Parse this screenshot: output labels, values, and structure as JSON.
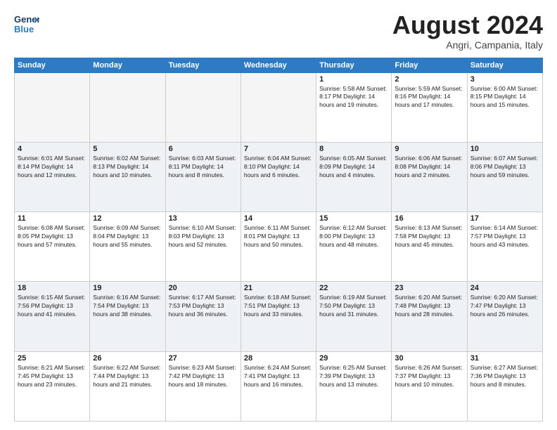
{
  "header": {
    "logo_line1": "General",
    "logo_line2": "Blue",
    "month": "August 2024",
    "location": "Angri, Campania, Italy"
  },
  "weekdays": [
    "Sunday",
    "Monday",
    "Tuesday",
    "Wednesday",
    "Thursday",
    "Friday",
    "Saturday"
  ],
  "weeks": [
    [
      {
        "day": "",
        "info": ""
      },
      {
        "day": "",
        "info": ""
      },
      {
        "day": "",
        "info": ""
      },
      {
        "day": "",
        "info": ""
      },
      {
        "day": "1",
        "info": "Sunrise: 5:58 AM\nSunset: 8:17 PM\nDaylight: 14 hours\nand 19 minutes."
      },
      {
        "day": "2",
        "info": "Sunrise: 5:59 AM\nSunset: 8:16 PM\nDaylight: 14 hours\nand 17 minutes."
      },
      {
        "day": "3",
        "info": "Sunrise: 6:00 AM\nSunset: 8:15 PM\nDaylight: 14 hours\nand 15 minutes."
      }
    ],
    [
      {
        "day": "4",
        "info": "Sunrise: 6:01 AM\nSunset: 8:14 PM\nDaylight: 14 hours\nand 12 minutes."
      },
      {
        "day": "5",
        "info": "Sunrise: 6:02 AM\nSunset: 8:13 PM\nDaylight: 14 hours\nand 10 minutes."
      },
      {
        "day": "6",
        "info": "Sunrise: 6:03 AM\nSunset: 8:11 PM\nDaylight: 14 hours\nand 8 minutes."
      },
      {
        "day": "7",
        "info": "Sunrise: 6:04 AM\nSunset: 8:10 PM\nDaylight: 14 hours\nand 6 minutes."
      },
      {
        "day": "8",
        "info": "Sunrise: 6:05 AM\nSunset: 8:09 PM\nDaylight: 14 hours\nand 4 minutes."
      },
      {
        "day": "9",
        "info": "Sunrise: 6:06 AM\nSunset: 8:08 PM\nDaylight: 14 hours\nand 2 minutes."
      },
      {
        "day": "10",
        "info": "Sunrise: 6:07 AM\nSunset: 8:06 PM\nDaylight: 13 hours\nand 59 minutes."
      }
    ],
    [
      {
        "day": "11",
        "info": "Sunrise: 6:08 AM\nSunset: 8:05 PM\nDaylight: 13 hours\nand 57 minutes."
      },
      {
        "day": "12",
        "info": "Sunrise: 6:09 AM\nSunset: 8:04 PM\nDaylight: 13 hours\nand 55 minutes."
      },
      {
        "day": "13",
        "info": "Sunrise: 6:10 AM\nSunset: 8:03 PM\nDaylight: 13 hours\nand 52 minutes."
      },
      {
        "day": "14",
        "info": "Sunrise: 6:11 AM\nSunset: 8:01 PM\nDaylight: 13 hours\nand 50 minutes."
      },
      {
        "day": "15",
        "info": "Sunrise: 6:12 AM\nSunset: 8:00 PM\nDaylight: 13 hours\nand 48 minutes."
      },
      {
        "day": "16",
        "info": "Sunrise: 6:13 AM\nSunset: 7:58 PM\nDaylight: 13 hours\nand 45 minutes."
      },
      {
        "day": "17",
        "info": "Sunrise: 6:14 AM\nSunset: 7:57 PM\nDaylight: 13 hours\nand 43 minutes."
      }
    ],
    [
      {
        "day": "18",
        "info": "Sunrise: 6:15 AM\nSunset: 7:56 PM\nDaylight: 13 hours\nand 41 minutes."
      },
      {
        "day": "19",
        "info": "Sunrise: 6:16 AM\nSunset: 7:54 PM\nDaylight: 13 hours\nand 38 minutes."
      },
      {
        "day": "20",
        "info": "Sunrise: 6:17 AM\nSunset: 7:53 PM\nDaylight: 13 hours\nand 36 minutes."
      },
      {
        "day": "21",
        "info": "Sunrise: 6:18 AM\nSunset: 7:51 PM\nDaylight: 13 hours\nand 33 minutes."
      },
      {
        "day": "22",
        "info": "Sunrise: 6:19 AM\nSunset: 7:50 PM\nDaylight: 13 hours\nand 31 minutes."
      },
      {
        "day": "23",
        "info": "Sunrise: 6:20 AM\nSunset: 7:48 PM\nDaylight: 13 hours\nand 28 minutes."
      },
      {
        "day": "24",
        "info": "Sunrise: 6:20 AM\nSunset: 7:47 PM\nDaylight: 13 hours\nand 26 minutes."
      }
    ],
    [
      {
        "day": "25",
        "info": "Sunrise: 6:21 AM\nSunset: 7:45 PM\nDaylight: 13 hours\nand 23 minutes."
      },
      {
        "day": "26",
        "info": "Sunrise: 6:22 AM\nSunset: 7:44 PM\nDaylight: 13 hours\nand 21 minutes."
      },
      {
        "day": "27",
        "info": "Sunrise: 6:23 AM\nSunset: 7:42 PM\nDaylight: 13 hours\nand 18 minutes."
      },
      {
        "day": "28",
        "info": "Sunrise: 6:24 AM\nSunset: 7:41 PM\nDaylight: 13 hours\nand 16 minutes."
      },
      {
        "day": "29",
        "info": "Sunrise: 6:25 AM\nSunset: 7:39 PM\nDaylight: 13 hours\nand 13 minutes."
      },
      {
        "day": "30",
        "info": "Sunrise: 6:26 AM\nSunset: 7:37 PM\nDaylight: 13 hours\nand 10 minutes."
      },
      {
        "day": "31",
        "info": "Sunrise: 6:27 AM\nSunset: 7:36 PM\nDaylight: 13 hours\nand 8 minutes."
      }
    ]
  ]
}
